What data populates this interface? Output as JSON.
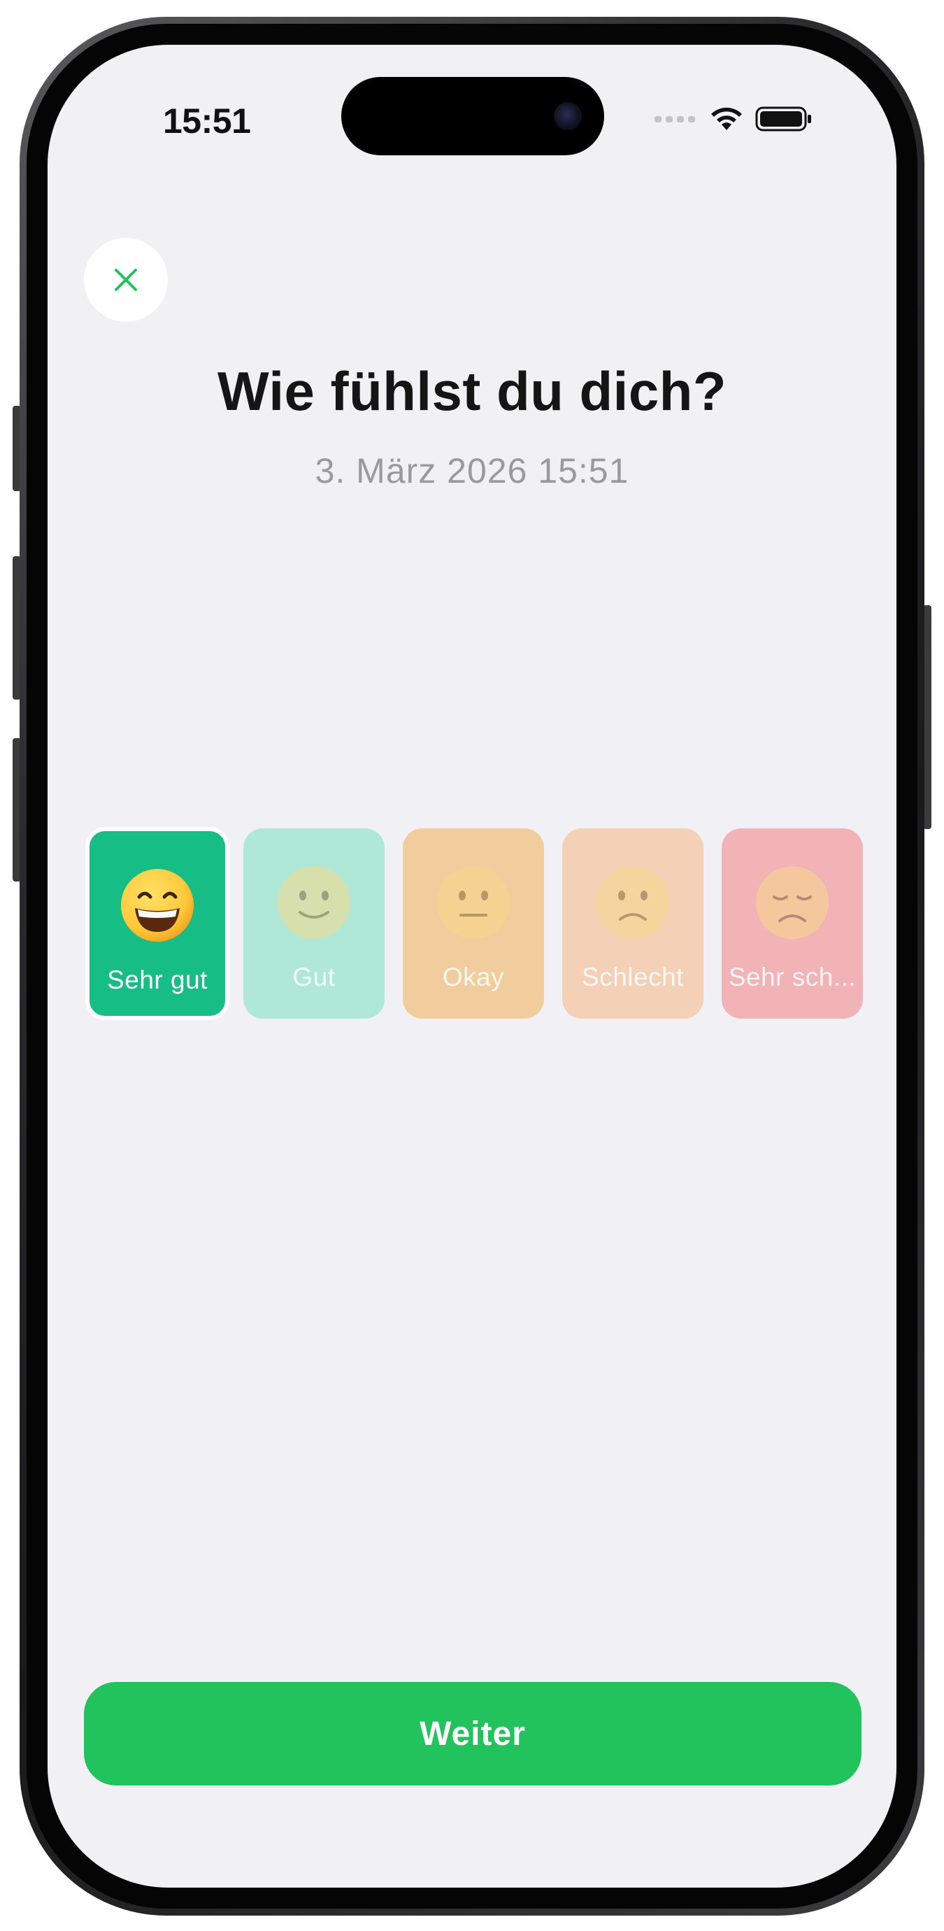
{
  "status_bar": {
    "time": "15:51",
    "signal_icon": "signal-dots-icon",
    "wifi_icon": "wifi-icon",
    "battery_icon": "battery-icon"
  },
  "header": {
    "close_icon": "close-x-icon",
    "title": "Wie fühlst du dich?",
    "datetime": "3. März 2026 15:51"
  },
  "moods": [
    {
      "label": "Sehr gut",
      "emoji": "grinning-face",
      "color": "#16bd85",
      "selected": true
    },
    {
      "label": "Gut",
      "emoji": "slightly-smiling-face",
      "color": "#b0e8d8",
      "selected": false
    },
    {
      "label": "Okay",
      "emoji": "neutral-face",
      "color": "#f1cd9e",
      "selected": false
    },
    {
      "label": "Schlecht",
      "emoji": "slightly-frowning-face",
      "color": "#f3d0b6",
      "selected": false
    },
    {
      "label": "Sehr sch...",
      "emoji": "disappointed-face",
      "color": "#f1b3b5",
      "selected": false
    }
  ],
  "footer": {
    "next_label": "Weiter"
  },
  "colors": {
    "accent": "#22c35c",
    "background": "#f1f0f5",
    "title": "#151515",
    "subtitle": "#9a9a9e"
  }
}
